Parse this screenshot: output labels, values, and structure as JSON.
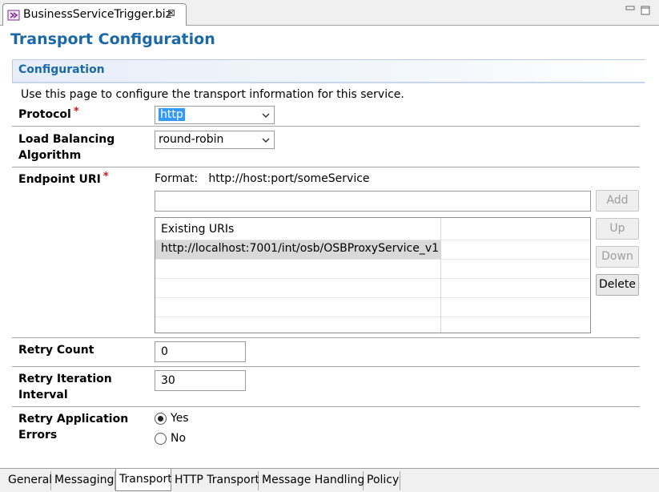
{
  "editor": {
    "tab_title": "BusinessServiceTrigger.biz",
    "close_glyph": "⊠",
    "icons": [
      "biz-file-icon",
      "minimize-icon",
      "maximize-icon"
    ]
  },
  "page": {
    "title": "Transport Configuration",
    "section_title": "Configuration",
    "description": "Use this page to configure the transport information for this service."
  },
  "protocol": {
    "label": "Protocol",
    "required_mark": "*",
    "value": "http"
  },
  "load_balancing": {
    "label_line1": "Load Balancing",
    "label_line2": "Algorithm",
    "value": "round-robin"
  },
  "endpoint": {
    "label": "Endpoint URI",
    "required_mark": "*",
    "format_label": "Format:",
    "format_value": "http://host:port/someService",
    "input_value": "",
    "table_header": "Existing URIs",
    "uris": [
      "http://localhost:7001/int/osb/OSBProxyService_v1"
    ],
    "buttons": {
      "add": "Add",
      "up": "Up",
      "down": "Down",
      "delete": "Delete"
    }
  },
  "retry_count": {
    "label": "Retry Count",
    "value": "0"
  },
  "retry_interval": {
    "label_line1": "Retry Iteration",
    "label_line2": "Interval",
    "value": "30"
  },
  "retry_app_errors": {
    "label_line1": "Retry Application",
    "label_line2": "Errors",
    "options": [
      "Yes",
      "No"
    ],
    "selected": "Yes"
  },
  "bottom_tabs": [
    "General",
    "Messaging",
    "Transport",
    "HTTP Transport",
    "Message Handling",
    "Policy"
  ],
  "active_tab": "Transport",
  "colors": {
    "title_blue": "#1a68a8",
    "selection_blue": "#3399ff",
    "required_red": "#dd1111"
  }
}
